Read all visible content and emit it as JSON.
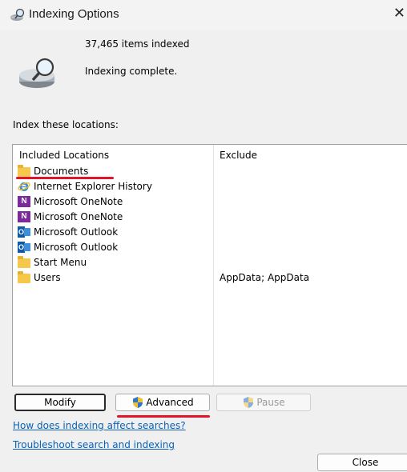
{
  "window": {
    "title": "Indexing Options",
    "close_glyph": "✕"
  },
  "summary": {
    "items_indexed": "37,465 items indexed",
    "status": "Indexing complete."
  },
  "locations": {
    "label": "Index these locations:",
    "headers": {
      "included": "Included Locations",
      "exclude": "Exclude"
    },
    "rows": [
      {
        "name": "Documents",
        "icon": "folder-icon",
        "exclude": ""
      },
      {
        "name": "Internet Explorer History",
        "icon": "internet-explorer-icon",
        "exclude": ""
      },
      {
        "name": "Microsoft OneNote",
        "icon": "onenote-icon",
        "exclude": ""
      },
      {
        "name": "Microsoft OneNote",
        "icon": "onenote-icon",
        "exclude": ""
      },
      {
        "name": "Microsoft Outlook",
        "icon": "outlook-icon",
        "exclude": ""
      },
      {
        "name": "Microsoft Outlook",
        "icon": "outlook-icon",
        "exclude": ""
      },
      {
        "name": "Start Menu",
        "icon": "folder-icon",
        "exclude": ""
      },
      {
        "name": "Users",
        "icon": "folder-icon",
        "exclude": "AppData; AppData"
      }
    ]
  },
  "buttons": {
    "modify": "Modify",
    "advanced": "Advanced",
    "pause": "Pause",
    "close": "Close"
  },
  "links": {
    "indexing_affect": "How does indexing affect searches?",
    "troubleshoot": "Troubleshoot search and indexing"
  },
  "colors": {
    "annotation_red": "#e0142a",
    "link_blue": "#0a61b5",
    "folder_yellow": "#f5c84c"
  }
}
